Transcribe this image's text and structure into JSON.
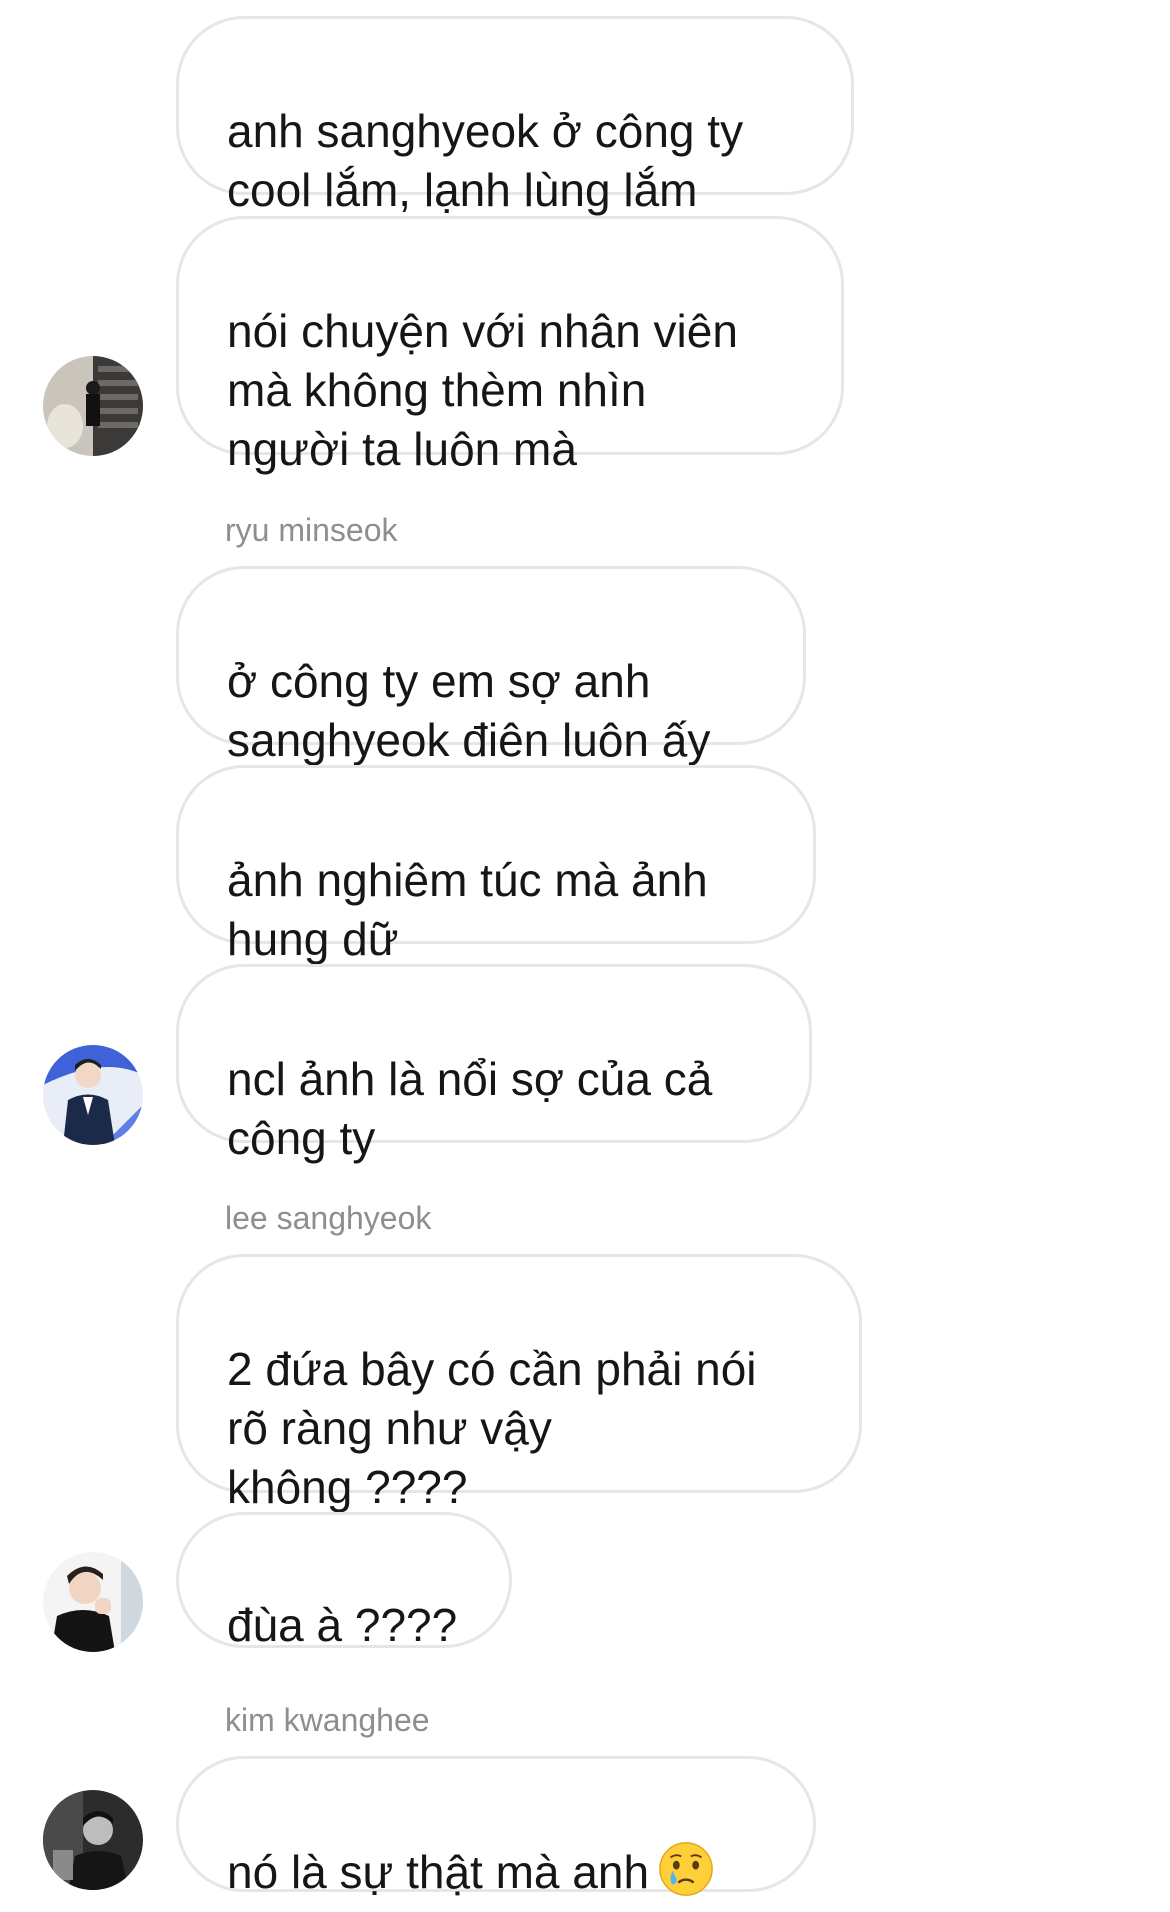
{
  "messages": [
    {
      "text": "anh sanghyeok ở công ty\ncool lắm, lạnh lùng lắm"
    },
    {
      "text": "nói chuyện với nhân viên\nmà không thèm nhìn\nngười ta luôn mà"
    },
    {
      "text": "ở công ty em sợ anh\nsanghyeok điên luôn ấy"
    },
    {
      "text": "ảnh nghiêm túc mà ảnh\nhung dữ"
    },
    {
      "text": "ncl ảnh là nổi sợ của cả\ncông ty"
    },
    {
      "text": "2 đứa bây có cần phải nói\nrõ ràng như vậy\nkhông ????"
    },
    {
      "text": "đùa à ????"
    },
    {
      "text": "nó là sự thật mà anh",
      "emoji": "crying-face-emoji"
    }
  ],
  "senders": {
    "ryu": "ryu minseok",
    "lee": "lee sanghyeok",
    "kim": "kim kwanghee"
  },
  "avatars": [
    "avatar-1",
    "avatar-ryu",
    "avatar-lee",
    "avatar-kim"
  ],
  "colors": {
    "bubble_border": "#e6e6e6",
    "sender_name": "#8e8e8e",
    "text": "#161616",
    "background": "#ffffff"
  }
}
